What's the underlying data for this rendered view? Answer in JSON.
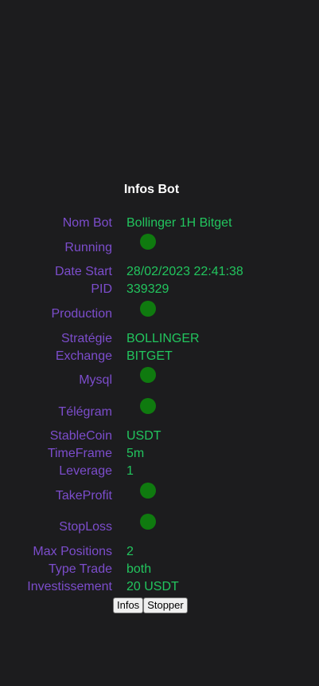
{
  "title": "Infos Bot",
  "colors": {
    "background": "#1c1c1e",
    "label": "#7c4dcc",
    "value": "#22c55e",
    "status_on": "#0f7a0f"
  },
  "fields": {
    "nom_bot": {
      "label": "Nom Bot",
      "value": "Bollinger 1H Bitget"
    },
    "running": {
      "label": "Running",
      "status": "on"
    },
    "date_start": {
      "label": "Date Start",
      "value": "28/02/2023 22:41:38"
    },
    "pid": {
      "label": "PID",
      "value": "339329"
    },
    "production": {
      "label": "Production",
      "status": "on"
    },
    "strategie": {
      "label": "Stratégie",
      "value": "BOLLINGER"
    },
    "exchange": {
      "label": "Exchange",
      "value": "BITGET"
    },
    "mysql": {
      "label": "Mysql",
      "status": "on"
    },
    "telegram": {
      "label": "Télégram",
      "status": "on"
    },
    "stablecoin": {
      "label": "StableCoin",
      "value": "USDT"
    },
    "timeframe": {
      "label": "TimeFrame",
      "value": "5m"
    },
    "leverage": {
      "label": "Leverage",
      "value": "1"
    },
    "takeprofit": {
      "label": "TakeProfit",
      "status": "on"
    },
    "stoploss": {
      "label": "StopLoss",
      "status": "on"
    },
    "max_positions": {
      "label": "Max Positions",
      "value": "2"
    },
    "type_trade": {
      "label": "Type Trade",
      "value": "both"
    },
    "investissement": {
      "label": "Investissement",
      "value": "20 USDT"
    }
  },
  "buttons": {
    "infos": "Infos",
    "stopper": "Stopper"
  }
}
